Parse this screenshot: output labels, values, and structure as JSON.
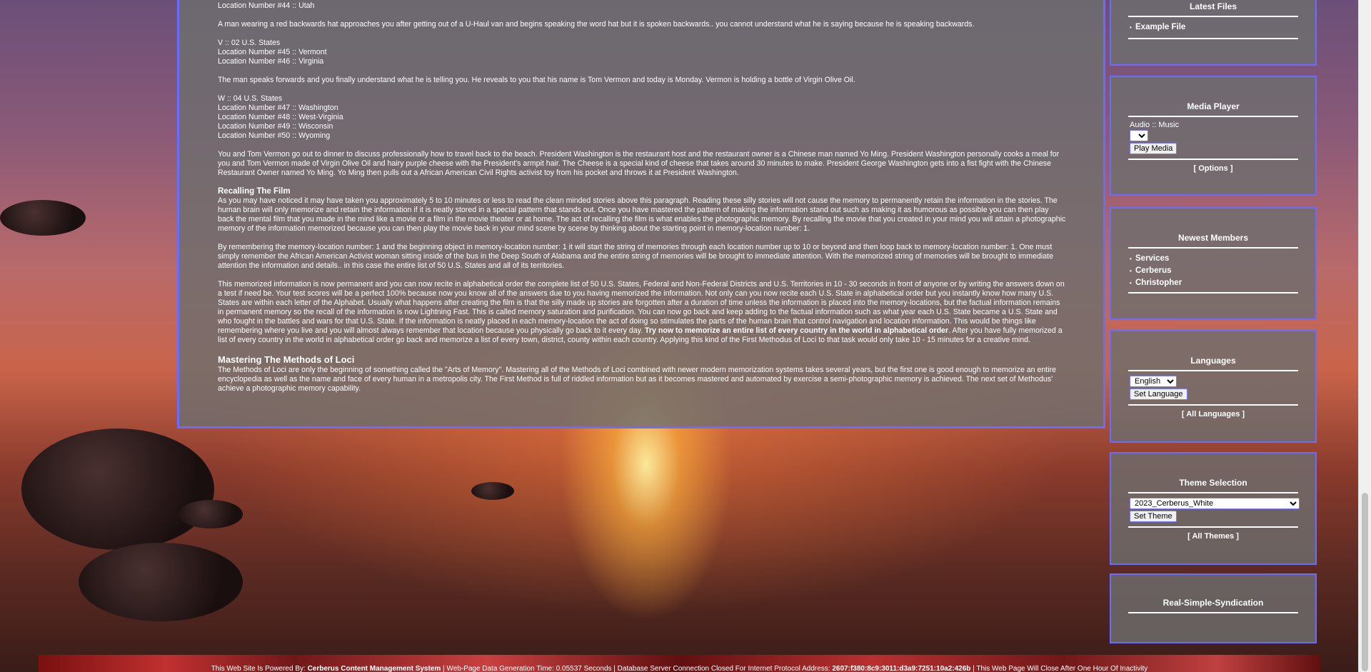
{
  "main": {
    "paragraphs": [
      "Location Number #44 :: Utah",
      "A man wearing a red backwards hat approaches you after getting out of a U-Haul van and begins speaking the word hat but it is spoken backwards.. you cannot understand what he is saying because he is speaking backwards.",
      "V :: 02 U.S. States\nLocation Number #45 :: Vermont\nLocation Number #46 :: Virginia",
      "The man speaks forwards and you finally understand what he is telling you. He reveals to you that his name is Tom Vermon and today is Monday. Vermon is holding a bottle of Virgin Olive Oil.",
      "W :: 04 U.S. States\nLocation Number #47 :: Washington\nLocation Number #48 :: West-Virginia\nLocation Number #49 :: Wisconsin\nLocation Number #50 :: Wyoming",
      "You and Tom Vermon go out to dinner to discuss professionally how to travel back to the beach. President Washington is the restaurant host and the restaurant owner is a Chinese man named Yo Ming. President Washington personally cooks a meal for you and Tom Vermon made of Virgin Olive Oil and hairy purple cheese with the President's armpit hair. The Cheese is a special kind of cheese that takes around 30 minutes to make. President George Washington gets into a fist fight with the Chinese Restaurant Owner named Yo Ming. Yo Ming then pulls out a African American Civil Rights activist toy from his pocket and throws it at President Washington."
    ],
    "recalling_heading": "Recalling The Film",
    "recalling_paragraphs": [
      "As you may have noticed it may have taken you approximately 5 to 10 minutes or less to read the clean minded stories above this paragraph. Reading these silly stories will not cause the memory to permanently retain the information in the stories. The human brain will only memorize and retain the information if it is neatly stored in a special pattern that stands out. Once you have mastered the pattern of making the information stand out such as making it as humorous as possible you can then play back the mental film that you made in the mind like a movie or a film in the movie theater or at home. The act of recalling the film is what enables the photographic memory. By recalling the movie that you created in your mind you will attain a photographic memory of the information memorized because you can then play the movie back in your mind scene by scene by thinking about the starting point in memory-location number: 1.",
      "By remembering the memory-location number: 1 and the beginning object in memory-location number: 1 it will start the string of memories through each location number up to 10 or beyond and then loop back to memory-location number: 1. One must simply remember the African American Activist woman sitting inside of the bus in the Deep South of Alabama and the entire string of memories will be brought to immediate attention. With the memorized string of memories will be brought to immediate attention the information and details.. in this case the entire list of 50 U.S. States and all of its territories."
    ],
    "memorized_paragraph_start": "This memorized information is now permanent and you can now recite in alphabetical order the complete list of 50 U.S. States, Federal and Non-Federal Districts and U.S. Territories in 10 - 30 seconds in front of anyone or by writing the answers down on a test if need be. Your test scores will be a perfect 100% because now you know all of the answers due to you having memorized the information. Not only can you now recite each U.S. State in alphabetical order but you instantly know how many U.S. States are within each letter of the Alphabet. Usually what happens after creating the film is that the silly made up stories are forgotten after a duration of time unless the information is placed into the memory-locations, but the factual information remains in permanent memory so the recall of the information is now Lightning Fast. This is called memory saturation and purification. You can now go back and keep adding to the factual information such as what year each U.S. State became a U.S. State and who fought in the battles and wars for that U.S. State. If the information is neatly placed in each memory-location the act of doing so stimulates the parts of the human brain that control navigation and location information. This would be things like remembering where you live and you will almost always remember that location because you physically go back to it every day. ",
    "memorized_paragraph_bold": "Try now to memorize an entire list of every country in the world in alphabetical order",
    "memorized_paragraph_end": ". After you have fully memorized a list of every country in the world in alphabetical order go back and memorize a list of every town, district, county within each country. Applying this kind of the First Methodus of Loci to that task would only take 10 - 15 minutes for a creative mind.",
    "mastering_heading": "Mastering The Methods of Loci",
    "mastering_paragraph": "The Methods of Loci are only the beginning of something called the \"Arts of Memory\". Mastering all of the Methods of Loci combined with newer modern memorization systems takes several years, but the first one is good enough to memorize an entire encyclopedia as well as the name and face of every human in a metropolis city. The First Method is full of riddled information but as it becomes mastered and automated by exercise a semi-photographic memory is achieved. The next set of Methodus' achieve a photographic memory capability."
  },
  "sidebar": {
    "latest_files": {
      "title": "Latest Files",
      "items": [
        "Example File"
      ]
    },
    "media_player": {
      "title": "Media Player",
      "label": "Audio :: Music",
      "play_label": "Play Media",
      "options_link": "[ Options ]"
    },
    "newest_members": {
      "title": "Newest Members",
      "items": [
        "Services",
        "Cerberus",
        "Christopher"
      ]
    },
    "languages": {
      "title": "Languages",
      "selected": "English",
      "set_label": "Set Language",
      "all_link": "[ All Languages ]"
    },
    "theme": {
      "title": "Theme Selection",
      "selected": "2023_Cerberus_White",
      "set_label": "Set Theme",
      "all_link": "[ All Themes ]"
    },
    "rss": {
      "title": "Real-Simple-Syndication"
    }
  },
  "footer": {
    "prefix": "This Web Site Is Powered By: ",
    "cms_name": "Cerberus Content Management System",
    "middle": " | Web-Page Data Generation Time: 0.05537 Seconds | Database Server Connection Closed For Internet Protocol Address: ",
    "ip": "2607:f380:8c9:3011:d3a9:7251:10a2:426b",
    "suffix": " | This Web Page Will Close After One Hour Of Inactivity"
  },
  "colors": {
    "panel_border": "#6a6cff",
    "panel_bg": "rgba(110,110,110,0.82)",
    "text": "#ffffff"
  }
}
